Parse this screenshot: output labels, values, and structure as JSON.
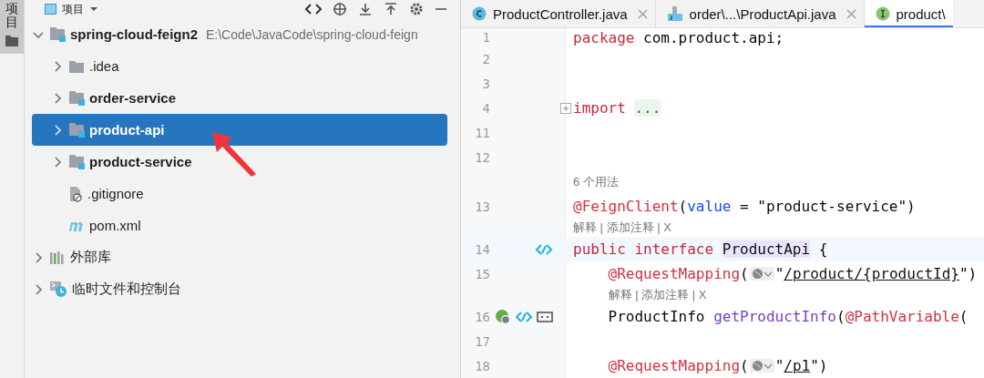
{
  "tool_strip": {
    "tabs": [
      {
        "label": "项目",
        "selected": true
      }
    ]
  },
  "project_panel": {
    "title": "项目",
    "tree": [
      {
        "label": "spring-cloud-feign2",
        "kind": "module",
        "path": "E:\\Code\\JavaCode\\spring-cloud-feign",
        "expanded": true,
        "selected": false,
        "children": [
          {
            "label": ".idea",
            "kind": "folder",
            "expanded": false,
            "selected": false
          },
          {
            "label": "order-service",
            "kind": "module",
            "expanded": false,
            "selected": false
          },
          {
            "label": "product-api",
            "kind": "module",
            "expanded": false,
            "selected": true
          },
          {
            "label": "product-service",
            "kind": "module",
            "expanded": false,
            "selected": false
          },
          {
            "label": ".gitignore",
            "kind": "ignore-file",
            "selected": false
          },
          {
            "label": "pom.xml",
            "kind": "maven",
            "selected": false
          }
        ]
      },
      {
        "label": "外部库",
        "kind": "library",
        "expanded": false,
        "selected": false
      },
      {
        "label": "临时文件和控制台",
        "kind": "scratch",
        "expanded": false,
        "selected": false
      }
    ]
  },
  "editor": {
    "tabs": [
      {
        "label": "ProductController.java",
        "kind": "class",
        "selected": false,
        "closable": true
      },
      {
        "label": "order\\...\\ProductApi.java",
        "kind": "file",
        "selected": false,
        "closable": true
      },
      {
        "label": "product\\",
        "kind": "interface",
        "selected": true,
        "closable": false
      }
    ],
    "lines": [
      {
        "kind": "code",
        "number": "1",
        "tokens": [
          {
            "kind": "keyword",
            "text": "package"
          },
          {
            "kind": "plain",
            "text": " com.product.api;"
          }
        ]
      },
      {
        "kind": "code",
        "number": "2"
      },
      {
        "kind": "code",
        "number": "3"
      },
      {
        "kind": "code",
        "number": "4",
        "folded": true,
        "tokens": [
          {
            "kind": "keyword",
            "text": "import "
          },
          {
            "kind": "folded",
            "text": "..."
          }
        ]
      },
      {
        "kind": "code",
        "number": "11"
      },
      {
        "kind": "code",
        "number": "12"
      },
      {
        "kind": "usage",
        "text": "6 个用法"
      },
      {
        "kind": "code",
        "number": "13",
        "tokens": [
          {
            "kind": "annotation",
            "text": "@FeignClient"
          },
          {
            "kind": "plain",
            "text": "("
          },
          {
            "kind": "param",
            "text": "value"
          },
          {
            "kind": "plain",
            "text": " = \"product-service\")"
          }
        ]
      },
      {
        "kind": "hint",
        "text": "解释 | 添加注释 | X"
      },
      {
        "kind": "code",
        "number": "14",
        "current": true,
        "gutter": [
          {
            "kind": "link"
          }
        ],
        "tokens": [
          {
            "kind": "keyword",
            "text": "public interface "
          },
          {
            "kind": "declaration",
            "text": "ProductApi"
          },
          {
            "kind": "plain",
            "text": " {"
          }
        ]
      },
      {
        "kind": "code",
        "number": "15",
        "tokens": [
          {
            "kind": "annotation",
            "text": "    @RequestMapping"
          },
          {
            "kind": "plain",
            "text": "("
          },
          {
            "kind": "inlay"
          },
          {
            "kind": "plain",
            "text": "\""
          },
          {
            "kind": "url",
            "text": "/product/{productId}"
          },
          {
            "kind": "plain",
            "text": "\")"
          }
        ]
      },
      {
        "kind": "hint",
        "text": "解释 | 添加注释 | X"
      },
      {
        "kind": "code",
        "number": "16",
        "gutter": [
          {
            "kind": "globe"
          },
          {
            "kind": "link"
          },
          {
            "kind": "endpoint"
          }
        ],
        "tokens": [
          {
            "kind": "plain",
            "text": "    ProductInfo "
          },
          {
            "kind": "method",
            "text": "getProductInfo"
          },
          {
            "kind": "plain",
            "text": "("
          },
          {
            "kind": "annotation",
            "text": "@PathVariable"
          },
          {
            "kind": "plain",
            "text": "("
          }
        ]
      },
      {
        "kind": "code",
        "number": "17"
      },
      {
        "kind": "code",
        "number": "18",
        "tokens": [
          {
            "kind": "annotation",
            "text": "    @RequestMapping"
          },
          {
            "kind": "plain",
            "text": "("
          },
          {
            "kind": "inlay"
          },
          {
            "kind": "plain",
            "text": "\""
          },
          {
            "kind": "url",
            "text": "/p1"
          },
          {
            "kind": "plain",
            "text": "\")"
          }
        ]
      }
    ]
  }
}
